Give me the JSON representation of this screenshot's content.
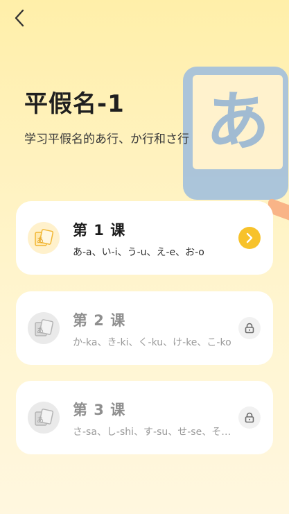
{
  "header": {
    "back_icon": "chevron-left-icon"
  },
  "hero": {
    "title": "平假名-1",
    "subtitle": "学习平假名的あ行、か行和さ行",
    "glyph": "あ"
  },
  "lessons": [
    {
      "name": "第 1 课",
      "desc": "あ-a、い-i、う-u、え-e、お-o",
      "state": "unlocked",
      "action_icon": "chevron-right-icon"
    },
    {
      "name": "第 2 课",
      "desc": "か-ka、き-ki、く-ku、け-ke、こ-ko",
      "state": "locked",
      "action_icon": "lock-icon"
    },
    {
      "name": "第 3 课",
      "desc": "さ-sa、し-shi、す-su、せ-se、そ-so",
      "state": "locked",
      "action_icon": "lock-icon"
    }
  ],
  "colors": {
    "accent": "#F7C22B",
    "hero_card": "#A7C2DB",
    "hero_glyph_bg": "#FFF3CF"
  }
}
